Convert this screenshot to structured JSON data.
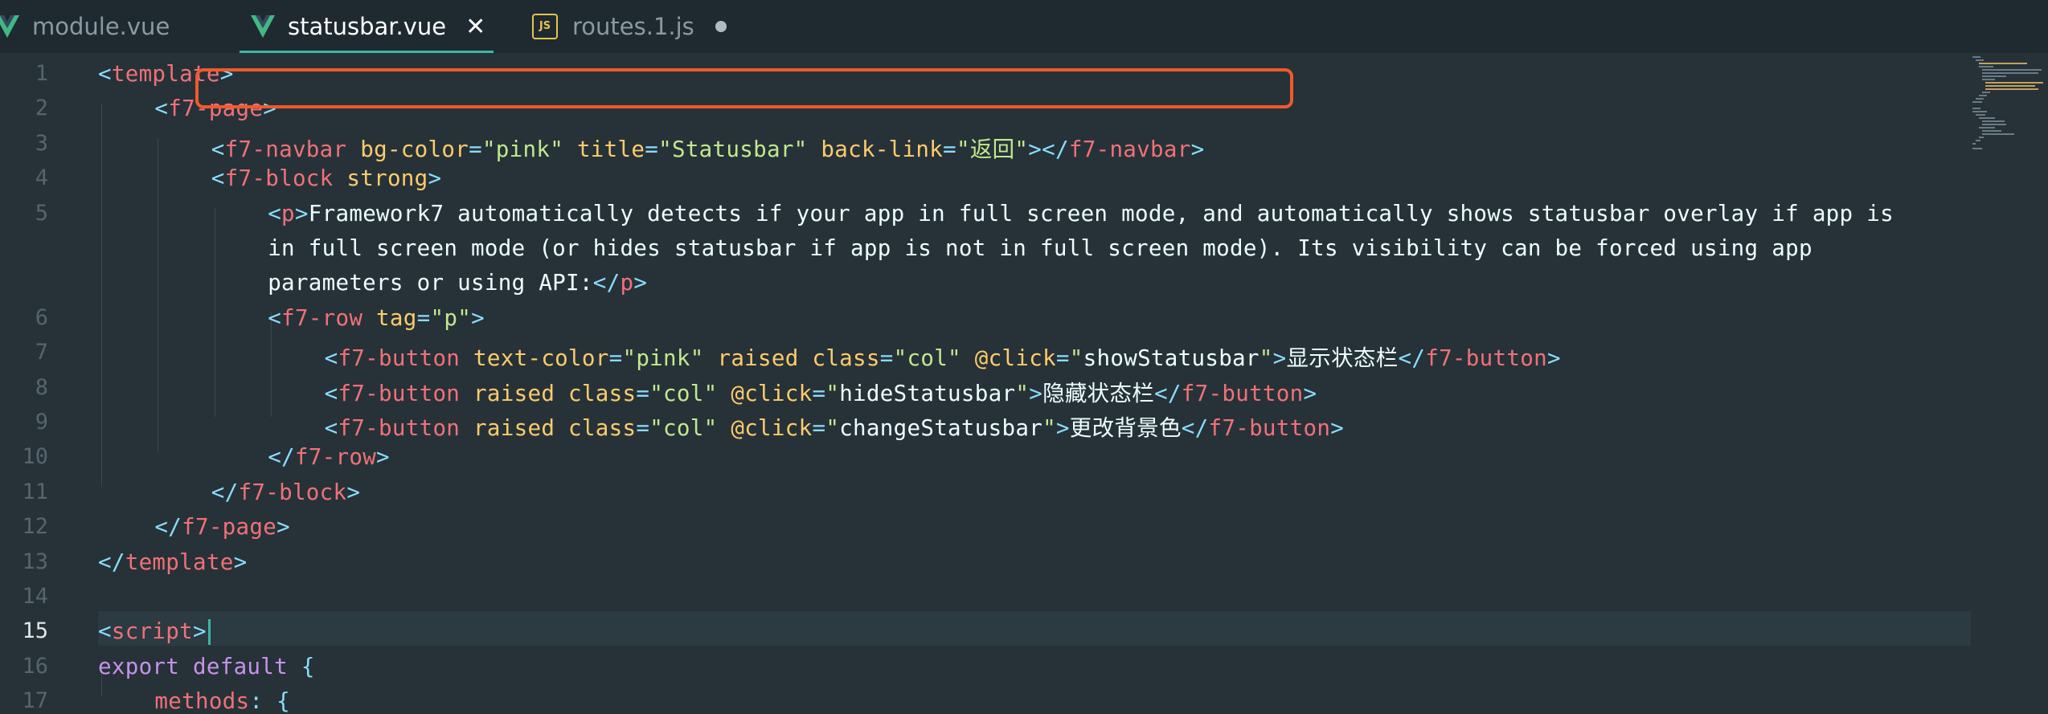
{
  "tabs": [
    {
      "name": "module.vue",
      "icon": "vue-icon",
      "active": false,
      "state": ""
    },
    {
      "name": "statusbar.vue",
      "icon": "vue-icon",
      "active": true,
      "state": "close"
    },
    {
      "name": "routes.1.js",
      "icon": "js-icon",
      "icon_label": "JS",
      "active": false,
      "state": "modified"
    }
  ],
  "colors": {
    "vue": "#41b883",
    "accent": "#3fb5a6",
    "highlight_box": "#ef5a2c",
    "background": "#263238"
  },
  "current_line": 15,
  "lines": [
    {
      "n": "1",
      "t": [
        [
          "tb",
          "<"
        ],
        [
          "tn",
          "template"
        ],
        [
          "tb",
          ">"
        ]
      ]
    },
    {
      "n": "2",
      "t": [
        [
          "tb",
          "<"
        ],
        [
          "tn",
          "f7-page"
        ],
        [
          "tb",
          ">"
        ]
      ]
    },
    {
      "n": "3",
      "t": [
        [
          "tb",
          "<"
        ],
        [
          "tn",
          "f7-navbar"
        ],
        [
          "p",
          " "
        ],
        [
          "at",
          "bg-color"
        ],
        [
          "tb",
          "="
        ],
        [
          "s",
          "\"pink\""
        ],
        [
          "p",
          " "
        ],
        [
          "at",
          "title"
        ],
        [
          "tb",
          "="
        ],
        [
          "s",
          "\"Statusbar\""
        ],
        [
          "p",
          " "
        ],
        [
          "at",
          "back-link"
        ],
        [
          "tb",
          "="
        ],
        [
          "s",
          "\"返回\""
        ],
        [
          "tb",
          "></"
        ],
        [
          "tn",
          "f7-navbar"
        ],
        [
          "tb",
          ">"
        ]
      ]
    },
    {
      "n": "4",
      "t": [
        [
          "tb",
          "<"
        ],
        [
          "tn",
          "f7-block"
        ],
        [
          "p",
          " "
        ],
        [
          "at",
          "strong"
        ],
        [
          "tb",
          ">"
        ]
      ]
    },
    {
      "n": "5",
      "t": [
        [
          "tb",
          "<"
        ],
        [
          "tn",
          "p"
        ],
        [
          "tb",
          ">"
        ],
        [
          "p",
          "Framework7 automatically detects if your app in full screen mode, and automatically shows statusbar overlay if app is"
        ]
      ]
    },
    {
      "n": "",
      "t": [
        [
          "p",
          "in full screen mode (or hides statusbar if app is not in full screen mode). Its visibility can be forced using app"
        ]
      ]
    },
    {
      "n": "",
      "t": [
        [
          "p",
          "parameters or using API:"
        ],
        [
          "tb",
          "</"
        ],
        [
          "tn",
          "p"
        ],
        [
          "tb",
          ">"
        ]
      ]
    },
    {
      "n": "6",
      "t": [
        [
          "tb",
          "<"
        ],
        [
          "tn",
          "f7-row"
        ],
        [
          "p",
          " "
        ],
        [
          "at",
          "tag"
        ],
        [
          "tb",
          "="
        ],
        [
          "s",
          "\"p\""
        ],
        [
          "tb",
          ">"
        ]
      ]
    },
    {
      "n": "7",
      "t": [
        [
          "tb",
          "<"
        ],
        [
          "tn",
          "f7-button"
        ],
        [
          "p",
          " "
        ],
        [
          "at",
          "text-color"
        ],
        [
          "tb",
          "="
        ],
        [
          "s",
          "\"pink\""
        ],
        [
          "p",
          " "
        ],
        [
          "at",
          "raised"
        ],
        [
          "p",
          " "
        ],
        [
          "at",
          "class"
        ],
        [
          "tb",
          "="
        ],
        [
          "s",
          "\"col\""
        ],
        [
          "p",
          " "
        ],
        [
          "at",
          "@click"
        ],
        [
          "tb",
          "="
        ],
        [
          "s",
          "\""
        ],
        [
          "p",
          "showStatusbar"
        ],
        [
          "s",
          "\""
        ],
        [
          "tb",
          ">"
        ],
        [
          "p",
          "显示状态栏"
        ],
        [
          "tb",
          "</"
        ],
        [
          "tn",
          "f7-button"
        ],
        [
          "tb",
          ">"
        ]
      ]
    },
    {
      "n": "8",
      "t": [
        [
          "tb",
          "<"
        ],
        [
          "tn",
          "f7-button"
        ],
        [
          "p",
          " "
        ],
        [
          "at",
          "raised"
        ],
        [
          "p",
          " "
        ],
        [
          "at",
          "class"
        ],
        [
          "tb",
          "="
        ],
        [
          "s",
          "\"col\""
        ],
        [
          "p",
          " "
        ],
        [
          "at",
          "@click"
        ],
        [
          "tb",
          "="
        ],
        [
          "s",
          "\""
        ],
        [
          "p",
          "hideStatusbar"
        ],
        [
          "s",
          "\""
        ],
        [
          "tb",
          ">"
        ],
        [
          "p",
          "隐藏状态栏"
        ],
        [
          "tb",
          "</"
        ],
        [
          "tn",
          "f7-button"
        ],
        [
          "tb",
          ">"
        ]
      ]
    },
    {
      "n": "9",
      "t": [
        [
          "tb",
          "<"
        ],
        [
          "tn",
          "f7-button"
        ],
        [
          "p",
          " "
        ],
        [
          "at",
          "raised"
        ],
        [
          "p",
          " "
        ],
        [
          "at",
          "class"
        ],
        [
          "tb",
          "="
        ],
        [
          "s",
          "\"col\""
        ],
        [
          "p",
          " "
        ],
        [
          "at",
          "@click"
        ],
        [
          "tb",
          "="
        ],
        [
          "s",
          "\""
        ],
        [
          "p",
          "changeStatusbar"
        ],
        [
          "s",
          "\""
        ],
        [
          "tb",
          ">"
        ],
        [
          "p",
          "更改背景色"
        ],
        [
          "tb",
          "</"
        ],
        [
          "tn",
          "f7-button"
        ],
        [
          "tb",
          ">"
        ]
      ]
    },
    {
      "n": "10",
      "t": [
        [
          "tb",
          "</"
        ],
        [
          "tn",
          "f7-row"
        ],
        [
          "tb",
          ">"
        ]
      ]
    },
    {
      "n": "11",
      "t": [
        [
          "tb",
          "</"
        ],
        [
          "tn",
          "f7-block"
        ],
        [
          "tb",
          ">"
        ]
      ]
    },
    {
      "n": "12",
      "t": [
        [
          "tb",
          "</"
        ],
        [
          "tn",
          "f7-page"
        ],
        [
          "tb",
          ">"
        ]
      ]
    },
    {
      "n": "13",
      "t": [
        [
          "tb",
          "</"
        ],
        [
          "tn",
          "template"
        ],
        [
          "tb",
          ">"
        ]
      ]
    },
    {
      "n": "14",
      "t": []
    },
    {
      "n": "15",
      "t": [
        [
          "tb",
          "<"
        ],
        [
          "tn",
          "script"
        ],
        [
          "tb",
          ">"
        ]
      ]
    },
    {
      "n": "16",
      "t": [
        [
          "kw",
          "export"
        ],
        [
          "p",
          " "
        ],
        [
          "kw",
          "default"
        ],
        [
          "p",
          " "
        ],
        [
          "tb",
          "{"
        ]
      ]
    },
    {
      "n": "17",
      "t": [
        [
          "tn",
          "methods"
        ],
        [
          "tb",
          ":"
        ],
        [
          "p",
          " "
        ],
        [
          "tb",
          "{"
        ]
      ]
    }
  ]
}
